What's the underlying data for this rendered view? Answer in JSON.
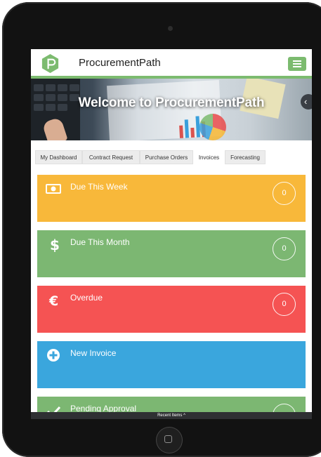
{
  "app": {
    "title": "ProcurementPath"
  },
  "hero": {
    "title": "Welcome to ProcurementPath"
  },
  "tabs": [
    {
      "label": "My Dashboard",
      "active": false
    },
    {
      "label": "Contract Request",
      "active": false
    },
    {
      "label": "Purchase Orders",
      "active": false
    },
    {
      "label": "Invoices",
      "active": true
    },
    {
      "label": "Forecasting",
      "active": false
    }
  ],
  "cards": [
    {
      "label": "Due This Week",
      "count": "0",
      "color": "#f8b83a",
      "icon": "banknote-icon"
    },
    {
      "label": "Due This Month",
      "count": "0",
      "color": "#7cb772",
      "icon": "dollar-icon"
    },
    {
      "label": "Overdue",
      "count": "0",
      "color": "#f55353",
      "icon": "euro-icon"
    },
    {
      "label": "New Invoice",
      "count": "",
      "color": "#3aa6dd",
      "icon": "plus-circle-icon"
    },
    {
      "label": "Pending Approval",
      "count": "",
      "color": "#7cb772",
      "icon": "checkmark-icon"
    }
  ],
  "footer": {
    "label": "Recent Items ^"
  },
  "colors": {
    "accent": "#7cbb6f",
    "device": "#121212"
  }
}
